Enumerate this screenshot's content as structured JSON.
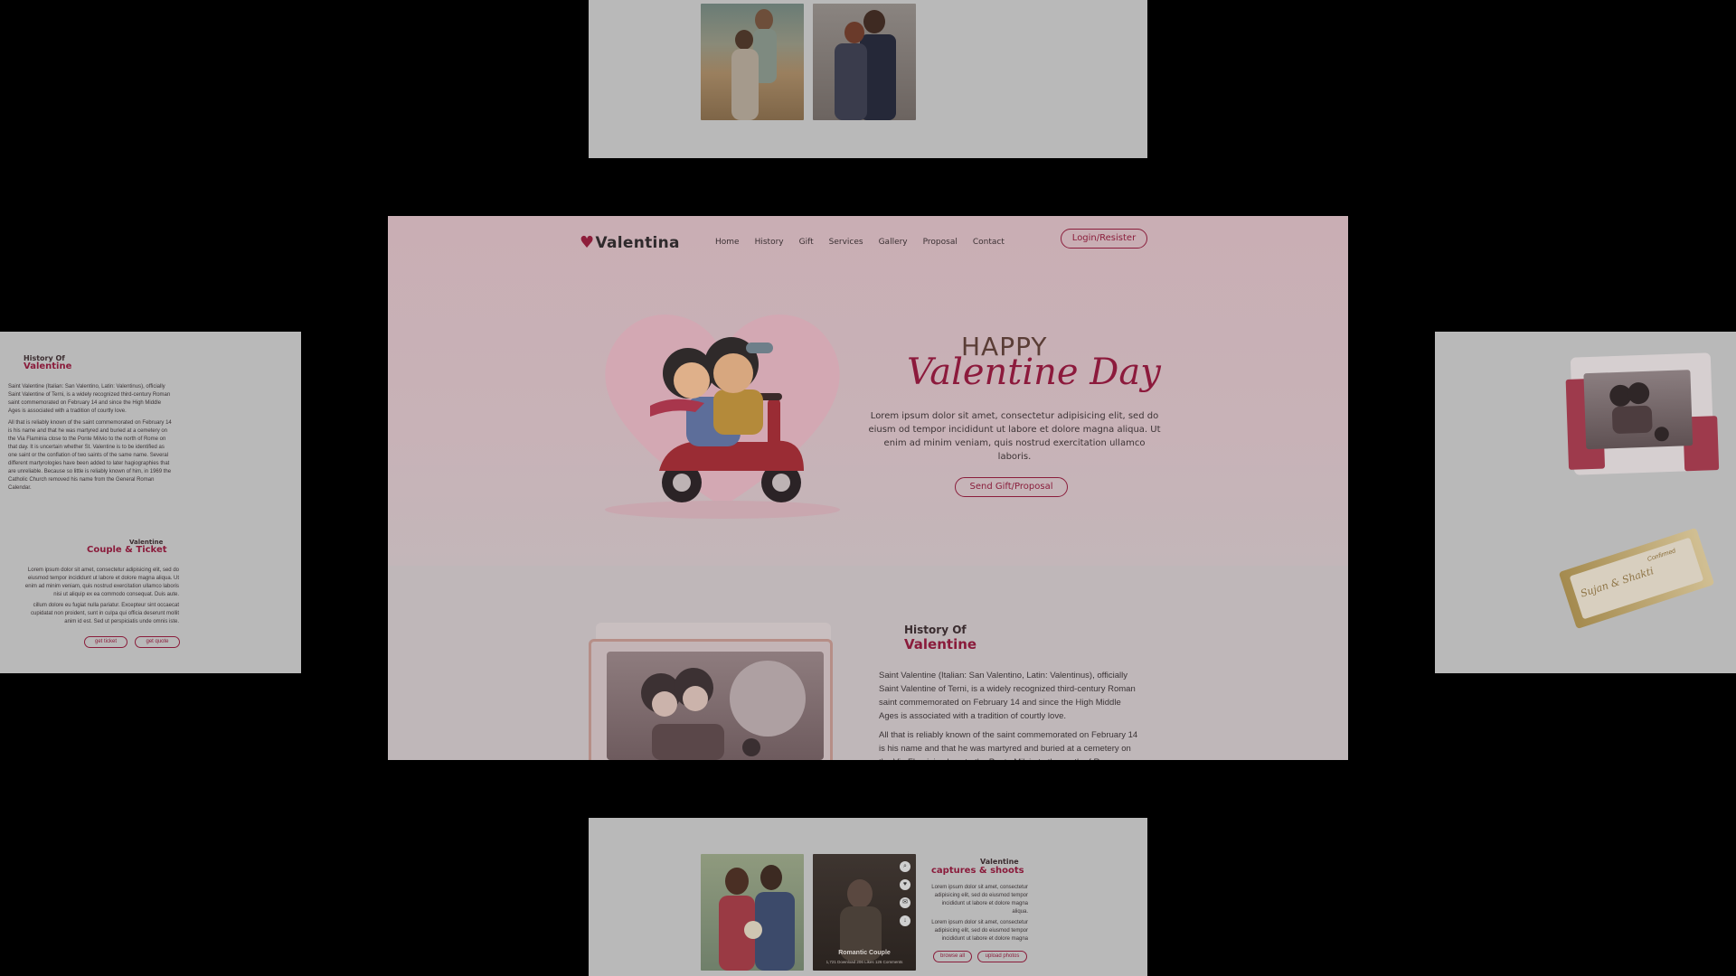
{
  "hero": {
    "logo": "Valentina",
    "nav": [
      "Home",
      "History",
      "Gift",
      "Services",
      "Gallery",
      "Proposal",
      "Contact"
    ],
    "login": "Login/Resister",
    "title_top": "HAPPY",
    "title_script": "Valentine Day",
    "text": "Lorem ipsum dolor sit amet, consectetur adipisicing elit, sed do eiusm od tempor incididunt ut labore et dolore magna aliqua. Ut enim ad minim veniam, quis nostrud exercitation ullamco laboris.",
    "cta": "Send Gift/Proposal"
  },
  "history": {
    "small": "History Of",
    "big": "Valentine",
    "p1": "Saint Valentine (Italian: San Valentino, Latin: Valentinus), officially Saint Valentine of Terni, is a widely recognized third-century Roman saint commemorated on February 14 and since the High Middle Ages is associated with a tradition of courtly love.",
    "p2": "All that is reliably known of the saint commemorated on February 14 is his name and that he was martyred and buried at a cemetery on the Via Flaminia close to the Ponte Milvio to the north of Rome"
  },
  "left_panel": {
    "small": "History Of",
    "big": "Valentine",
    "p1": "Saint Valentine (Italian: San Valentino, Latin: Valentinus), officially Saint Valentine of Terni, is a widely recognized third-century Roman saint commemorated on February 14 and since the High Middle Ages is associated with a tradition of courtly love.",
    "p2": "All that is reliably known of the saint commemorated on February 14 is his name and that he was martyred and buried at a cemetery on the Via Flaminia close to the Ponte Milvio to the north of Rome on that day. It is uncertain whether St. Valentine is to be identified as one saint or the conflation of two saints of the same name. Several different martyrologies have been added to later hagiographies that are unreliable. Because so little is reliably known of him, in 1969 the Catholic Church removed his name from the General Roman Calendar.",
    "couple_small": "Valentine",
    "couple_big": "Couple & Ticket",
    "couple_p1": "Lorem ipsum dolor sit amet, consectetur adipisicing elit, sed do eiusmod tempor incididunt ut labore et dolore magna aliqua. Ut enim ad minim veniam, quis nostrud exercitation ullamco laboris nisi ut aliquip ex ea commodo consequat. Duis aute.",
    "couple_p2": "cillum dolore eu fugiat nulla pariatur. Excepteur sint occaecat cupidatat non proident, sunt in culpa qui officia deserunt mollit anim id est. Sed ut perspiciatis unde omnis iste.",
    "btn1": "get ticket",
    "btn2": "get quote"
  },
  "right_panel": {
    "ticket_names": "Sujan & Shakti",
    "ticket_stamp": "Confirmed"
  },
  "bottom": {
    "small": "Valentine",
    "big": "captures & shoots",
    "p1": "Lorem ipsum dolor sit amet, consectetur adipisicing elit, sed do eiusmod tempor incididunt ut labore et dolore magna aliqua.",
    "p2": "Lorem ipsum dolor sit amet, consectetur adipisicing elit, sed do eiusmod tempor incididunt ut labore et dolore magna",
    "btn1": "browse all",
    "btn2": "upload photos",
    "card_title": "Romantic Couple",
    "card_meta": "1,721 Download  206 Likes  126 Comments"
  },
  "colors": {
    "accent": "#8a1d3b",
    "hero_bg": "#c9aeb4",
    "panel_bg": "#b9b9b9"
  }
}
